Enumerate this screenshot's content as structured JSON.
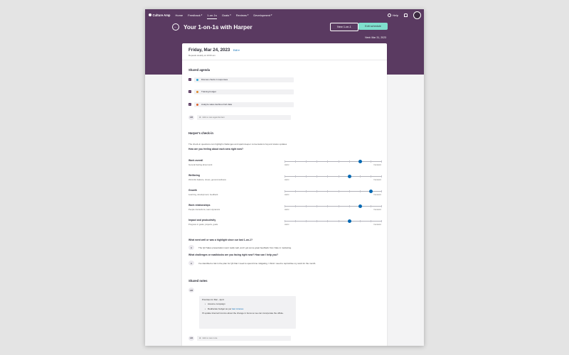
{
  "nav": {
    "logo": "Culture Amp",
    "items": [
      {
        "label": "Home",
        "caret": false,
        "active": false
      },
      {
        "label": "Feedback",
        "caret": true,
        "active": false
      },
      {
        "label": "1-on-1s",
        "caret": false,
        "active": true
      },
      {
        "label": "Goals",
        "caret": true,
        "active": false
      },
      {
        "label": "Reviews",
        "caret": true,
        "active": false
      },
      {
        "label": "Development",
        "caret": true,
        "active": false
      }
    ],
    "help": "Help"
  },
  "header": {
    "title": "Your 1-on-1s with Harper",
    "new_button": "New 1-on-1",
    "edit_button": "Edit schedule",
    "next_meeting": "Next: Mar 31, 2023"
  },
  "meeting": {
    "date": "Friday, Mar 24, 2023",
    "schedule_link": "Edit",
    "repeats": "Repeats weekly at 10:00 am"
  },
  "agenda": {
    "heading": "Shared agenda",
    "items": [
      {
        "text": "Discuss check-in responses",
        "icon_color": "#2ea8d6"
      },
      {
        "text": "Training budget",
        "icon_color": "#e08a2c"
      },
      {
        "text": "Analyze sales declines Feb data",
        "icon_color": "#e0612c"
      }
    ],
    "author_initials": "GM",
    "add_placeholder": "Add a new agenda item"
  },
  "checkin": {
    "heading": "Harper's check-in",
    "description": "The check-in questions can highlight challenges and spark deeper conversations beyond status updates",
    "question": "How are you feeling about each area right now?",
    "scale_low": "Awful",
    "scale_high": "Fantastic",
    "areas": [
      {
        "title": "Work overall",
        "subtitle": "General feeling about work",
        "value": 0.78
      },
      {
        "title": "Wellbeing",
        "subtitle": "Work-life balance, stress, general wellness",
        "value": 0.67
      },
      {
        "title": "Growth",
        "subtitle": "Learning, development, feedback",
        "value": 0.89
      },
      {
        "title": "Work relationships",
        "subtitle": "People interactions, team dynamics",
        "value": 0.78
      },
      {
        "title": "Impact and productivity",
        "subtitle": "Progress in goals, projects, goals",
        "value": 0.67
      }
    ],
    "q2": "What went well or was a highlight since our last 1-on-1?",
    "a2": "The Q2 Sales presentation went really well, and I got some great feedback from Kate in marketing.",
    "q3": "What challenges or roadblocks are you facing right now? How can I help you?",
    "a3": "I've identified a risk in the plan for Q3 that I need to spend time mitigating. I think I need to reprioritise my work for the month.",
    "responder_initials": "H"
  },
  "notes": {
    "heading": "Shared notes",
    "author_initials": "GM",
    "priorities": "Priorities for Mar - April:",
    "bullet1": "Assume campaign",
    "bullet2_prefix": "Reallocate budget as per",
    "bullet2_link": "last minutes",
    "followup": "I'll update Internal Comms about the change in focus so we can incorporate the offsite.",
    "add_placeholder": "Add a new note"
  }
}
